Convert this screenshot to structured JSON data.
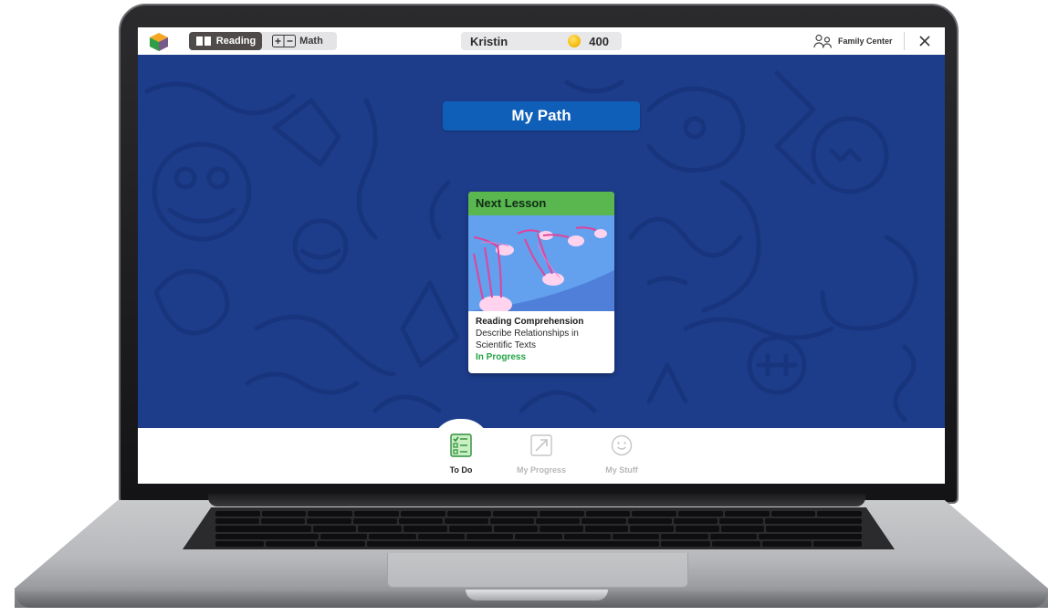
{
  "topbar": {
    "subjects": [
      {
        "label": "Reading",
        "active": true,
        "icon": "book-icon"
      },
      {
        "label": "Math",
        "active": false,
        "icon": "plus-minus-icon"
      }
    ],
    "user": {
      "name": "Kristin",
      "coins": "400",
      "coin_icon": "coin-icon"
    },
    "family_center_label": "Family Center",
    "close_icon": "close-icon"
  },
  "main": {
    "path_title": "My Path",
    "next_lesson_card": {
      "header": "Next Lesson",
      "subject": "Reading Comprehension",
      "topic": "Describe Relationships in Scientific Texts",
      "status": "In Progress",
      "image": "jellyfish-illustration"
    }
  },
  "bottom_nav": {
    "items": [
      {
        "label": "To Do",
        "icon": "checklist-icon",
        "active": true
      },
      {
        "label": "My Progress",
        "icon": "progress-arrow-icon",
        "active": false
      },
      {
        "label": "My Stuff",
        "icon": "smiley-icon",
        "active": false
      }
    ]
  },
  "colors": {
    "background_blue": "#1e3e8c",
    "title_blue": "#0f5fb8",
    "card_header_green": "#5ab64f",
    "status_green": "#22a344",
    "reading_tab": "#4f4b4b"
  }
}
